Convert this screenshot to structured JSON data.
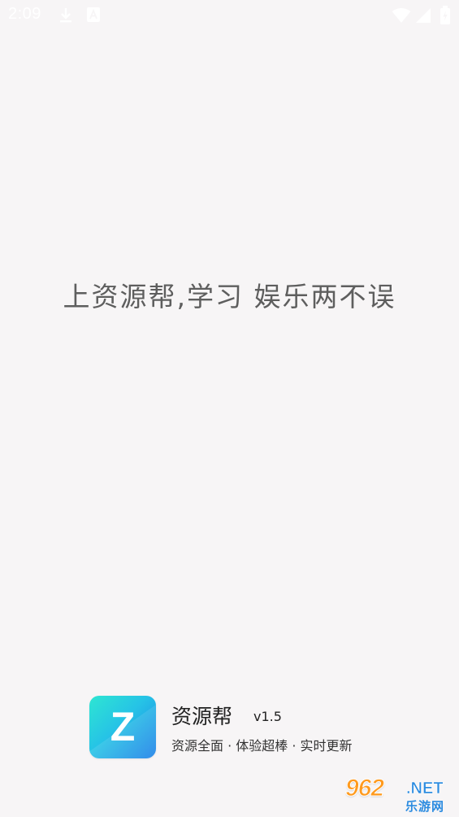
{
  "status_bar": {
    "time": "2:09",
    "icons": [
      "download-icon",
      "a-icon",
      "wifi-icon",
      "signal-icon",
      "battery-icon"
    ]
  },
  "splash": {
    "slogan": "上资源帮,学习 娱乐两不误"
  },
  "app": {
    "logo_letter": "Z",
    "name": "资源帮",
    "version": "v1.5",
    "tagline": "资源全面 · 体验超棒 · 实时更新"
  },
  "watermark": {
    "number": "962",
    "domain": ".NET",
    "subtitle": "乐游网"
  },
  "colors": {
    "background": "#f7f5f6",
    "logo_gradient_start": "#2ee6d2",
    "logo_gradient_end": "#1d7fe8",
    "watermark_orange": "#ff9a1e",
    "watermark_blue": "#2b8be0"
  }
}
